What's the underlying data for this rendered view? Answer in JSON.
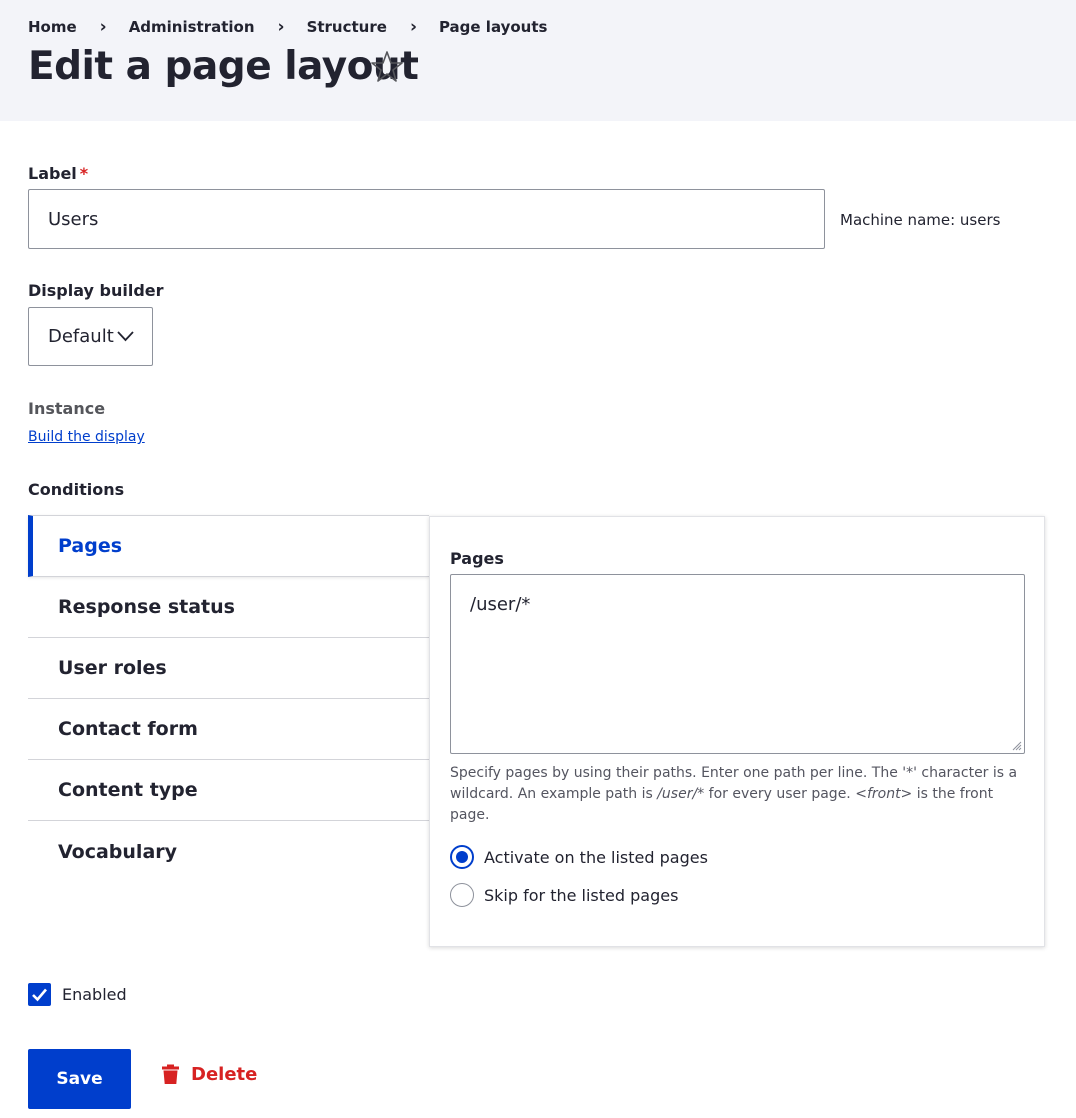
{
  "breadcrumb": {
    "items": [
      "Home",
      "Administration",
      "Structure",
      "Page layouts"
    ]
  },
  "page_title": "Edit a page layout",
  "star_icon": "star-outline-icon",
  "label_field": {
    "label": "Label",
    "required_marker": "*",
    "value": "Users",
    "machine_name": "Machine name: users"
  },
  "display_builder": {
    "label": "Display builder",
    "selected": "Default"
  },
  "instance": {
    "label": "Instance",
    "link": "Build the display"
  },
  "conditions": {
    "label": "Conditions",
    "tabs": [
      "Pages",
      "Response status",
      "User roles",
      "Contact form",
      "Content type",
      "Vocabulary"
    ],
    "active_tab": "Pages",
    "pages": {
      "label": "Pages",
      "value": "/user/*",
      "description_1": "Specify pages by using their paths. Enter one path per line. The '*' character is a wildcard. An example path is ",
      "description_em1": "/user/*",
      "description_2": " for every user page. ",
      "description_em2": "<front>",
      "description_3": " is the front page.",
      "radio_options": [
        "Activate on the listed pages",
        "Skip for the listed pages"
      ],
      "radio_selected": "Activate on the listed pages"
    }
  },
  "enabled": {
    "label": "Enabled",
    "checked": true
  },
  "actions": {
    "save": "Save",
    "delete": "Delete"
  },
  "colors": {
    "accent": "#003ecc",
    "danger": "#d72222",
    "header_bg": "#f3f4f9"
  }
}
